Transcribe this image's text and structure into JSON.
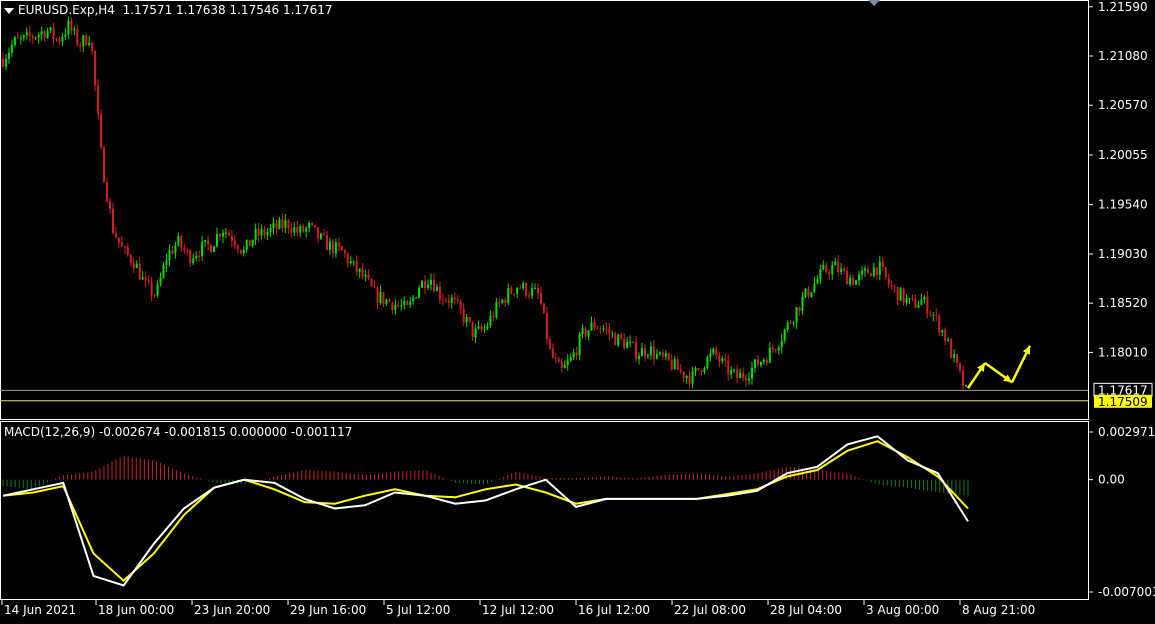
{
  "header": {
    "symbol": "EURUSD.Exp,H4",
    "open": "1.17571",
    "high": "1.17638",
    "low": "1.17546",
    "close": "1.17617"
  },
  "macd_header": {
    "name": "MACD(12,26,9)",
    "values": "-0.002674 -0.001815 0.000000 -0.001117"
  },
  "price_axis": {
    "ticks": [
      "1.21590",
      "1.21080",
      "1.20570",
      "1.20055",
      "1.19540",
      "1.19030",
      "1.18520",
      "1.18010"
    ],
    "current_price": "1.17617",
    "line_price": "1.17509"
  },
  "macd_axis": {
    "ticks": [
      "0.002971",
      "0.00",
      "-0.007003"
    ]
  },
  "time_axis": {
    "labels": [
      "14 Jun 2021",
      "18 Jun 00:00",
      "23 Jun 20:00",
      "29 Jun 16:00",
      "5 Jul 12:00",
      "12 Jul 12:00",
      "16 Jul 12:00",
      "22 Jul 08:00",
      "28 Jul 04:00",
      "3 Aug 00:00",
      "8 Aug 21:00"
    ]
  },
  "colors": {
    "background": "#000000",
    "bull": "#00e000",
    "bear": "#d42020",
    "macd_line": "#ffffff",
    "signal_line": "#ffff00",
    "hist_positive": "#c82828",
    "hist_negative": "#1a7a1a",
    "annotation_arrow": "#ffff00",
    "price_label_bg": "#ffff00"
  },
  "chart_data": {
    "type": "candlestick",
    "symbol": "EURUSD",
    "timeframe": "H4",
    "y_range": [
      1.1731,
      1.2166
    ],
    "price_path_close": [
      1.2105,
      1.2122,
      1.2125,
      1.213,
      1.2135,
      1.2124,
      1.2139,
      1.212,
      1.213,
      1.2002,
      1.193,
      1.1905,
      1.1895,
      1.187,
      1.186,
      1.1902,
      1.1915,
      1.19,
      1.1908,
      1.1912,
      1.193,
      1.192,
      1.1905,
      1.1922,
      1.1925,
      1.193,
      1.1935,
      1.1925,
      1.193,
      1.1918,
      1.191,
      1.1905,
      1.189,
      1.1878,
      1.186,
      1.1855,
      1.185,
      1.1845,
      1.187,
      1.188,
      1.186,
      1.1855,
      1.184,
      1.182,
      1.1825,
      1.1845,
      1.186,
      1.187,
      1.1865,
      1.186,
      1.18,
      1.178,
      1.1795,
      1.182,
      1.183,
      1.1825,
      1.1815,
      1.181,
      1.18,
      1.1805,
      1.1795,
      1.179,
      1.178,
      1.1775,
      1.179,
      1.18,
      1.1785,
      1.1775,
      1.178,
      1.179,
      1.18,
      1.1815,
      1.1835,
      1.1855,
      1.187,
      1.1885,
      1.189,
      1.188,
      1.1875,
      1.1885,
      1.189,
      1.187,
      1.186,
      1.185,
      1.1855,
      1.184,
      1.182,
      1.179,
      1.176
    ],
    "forecast_arrows_price": [
      1.1764,
      1.179,
      1.177,
      1.1808
    ],
    "macd_range": [
      -0.007003,
      0.002971
    ],
    "macd_main": [
      -0.001,
      -0.0006,
      -0.0002,
      -0.006,
      -0.0066,
      -0.004,
      -0.0018,
      -0.0005,
      0.0,
      -0.0002,
      -0.0012,
      -0.0018,
      -0.0016,
      -0.0008,
      -0.001,
      -0.0015,
      -0.0013,
      -0.0006,
      0.0,
      -0.0017,
      -0.0012,
      -0.0012,
      -0.0012,
      -0.0012,
      -0.001,
      -0.0007,
      0.0004,
      0.0008,
      0.0022,
      0.0027,
      0.0012,
      0.0004,
      -0.0026
    ],
    "macd_signal": [
      -0.001,
      -0.0008,
      -0.0004,
      -0.0046,
      -0.0063,
      -0.0046,
      -0.0022,
      -0.0005,
      0.0,
      -0.0006,
      -0.0014,
      -0.0015,
      -0.001,
      -0.0006,
      -0.001,
      -0.0011,
      -0.0006,
      -0.0003,
      -0.0008,
      -0.0015,
      -0.0012,
      -0.0012,
      -0.0012,
      -0.0012,
      -0.0009,
      -0.0006,
      0.0002,
      0.0006,
      0.0018,
      0.0024,
      0.0014,
      0.0002,
      -0.0018
    ],
    "macd_histogram": [
      -0.0004,
      -0.0006,
      0.0003,
      0.0005,
      0.0015,
      0.0012,
      0.0004,
      -0.0002,
      -0.0003,
      0.0002,
      0.0006,
      0.0005,
      0.0003,
      0.0005,
      0.0006,
      -0.0002,
      -0.0003,
      0.0005,
      0.0001,
      0.0001,
      0.0002,
      0.0001,
      0.0003,
      0.0004,
      0.0002,
      0.0004,
      0.0008,
      0.0006,
      0.0004,
      -0.0003,
      -0.0005,
      -0.0008,
      -0.001
    ]
  }
}
